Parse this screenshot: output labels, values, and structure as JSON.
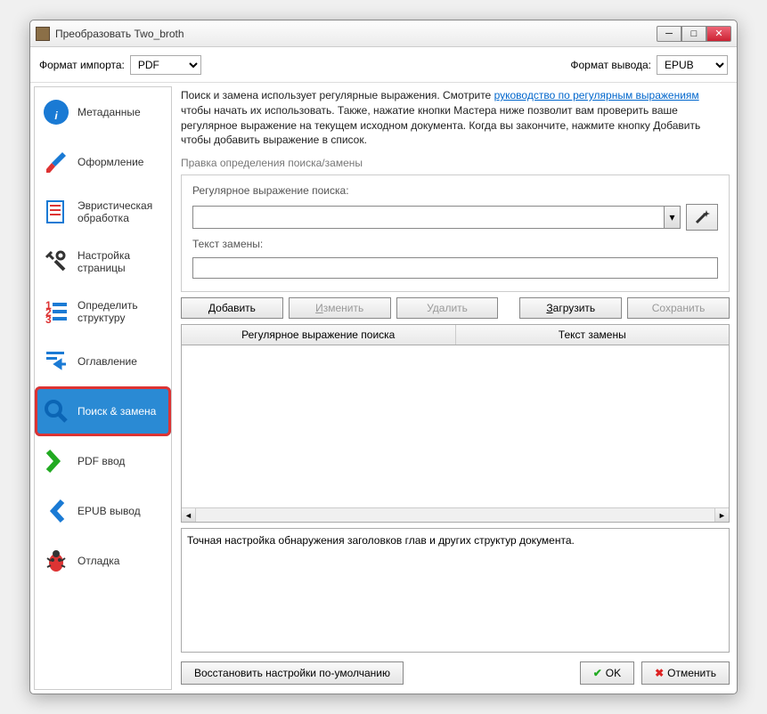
{
  "window": {
    "title": "Преобразовать Two_broth"
  },
  "formatbar": {
    "import_label": "Формат импорта:",
    "import_value": "PDF",
    "output_label": "Формат вывода:",
    "output_value": "EPUB"
  },
  "sidebar": {
    "items": [
      {
        "label": "Метаданные",
        "icon": "info"
      },
      {
        "label": "Оформление",
        "icon": "brush"
      },
      {
        "label": "Эвристическая обработка",
        "icon": "heuristic"
      },
      {
        "label": "Настройка страницы",
        "icon": "tools"
      },
      {
        "label": "Определить структуру",
        "icon": "structure"
      },
      {
        "label": "Оглавление",
        "icon": "toc"
      },
      {
        "label": "Поиск & замена",
        "icon": "search",
        "selected": true,
        "highlighted": true
      },
      {
        "label": "PDF ввод",
        "icon": "pdfin"
      },
      {
        "label": "EPUB вывод",
        "icon": "epubout"
      },
      {
        "label": "Отладка",
        "icon": "bug"
      }
    ]
  },
  "main": {
    "description_pre": "Поиск и замена использует регулярные выражения. Смотрите ",
    "description_link": "руководство по регулярным выражениям",
    "description_post": " чтобы начать их использовать. Также, нажатие кнопки Мастера ниже позволит вам проверить ваше регулярное выражение на текущем исходном документа. Когда вы закончите, нажмите кнопку Добавить чтобы добавить выражение в список.",
    "subheader": "Правка определения поиска/замены",
    "regex_label": "Регулярное выражение поиска:",
    "replace_label": "Текст замены:",
    "buttons": {
      "add": "Добавить",
      "edit": "Изменить",
      "delete": "Удалить",
      "load": "Загрузить",
      "save": "Сохранить"
    },
    "table": {
      "col1": "Регулярное выражение поиска",
      "col2": "Текст замены"
    },
    "info": "Точная настройка обнаружения заголовков глав и других структур документа."
  },
  "footer": {
    "restore": "Восстановить настройки по-умолчанию",
    "ok": "OK",
    "cancel": "Отменить"
  }
}
